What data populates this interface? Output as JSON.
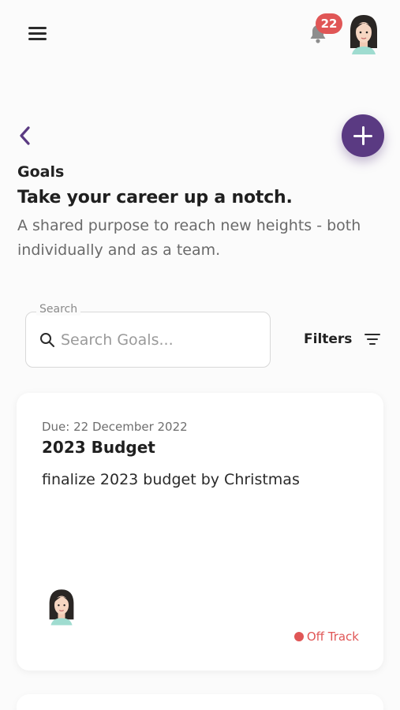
{
  "header": {
    "notification_count": "22"
  },
  "page": {
    "section_label": "Goals",
    "headline": "Take your career up a notch.",
    "subtext": "A shared purpose to reach new heights - both individually and as a team."
  },
  "search": {
    "legend": "Search",
    "placeholder": "Search Goals...",
    "value": ""
  },
  "filters": {
    "label": "Filters"
  },
  "goals": [
    {
      "due": "Due: 22 December 2022",
      "title": "2023 Budget",
      "description": "finalize 2023 budget by Christmas",
      "status": "Off Track",
      "status_color": "#e05656"
    }
  ],
  "colors": {
    "accent": "#5a3a82",
    "badge": "#e05656"
  }
}
